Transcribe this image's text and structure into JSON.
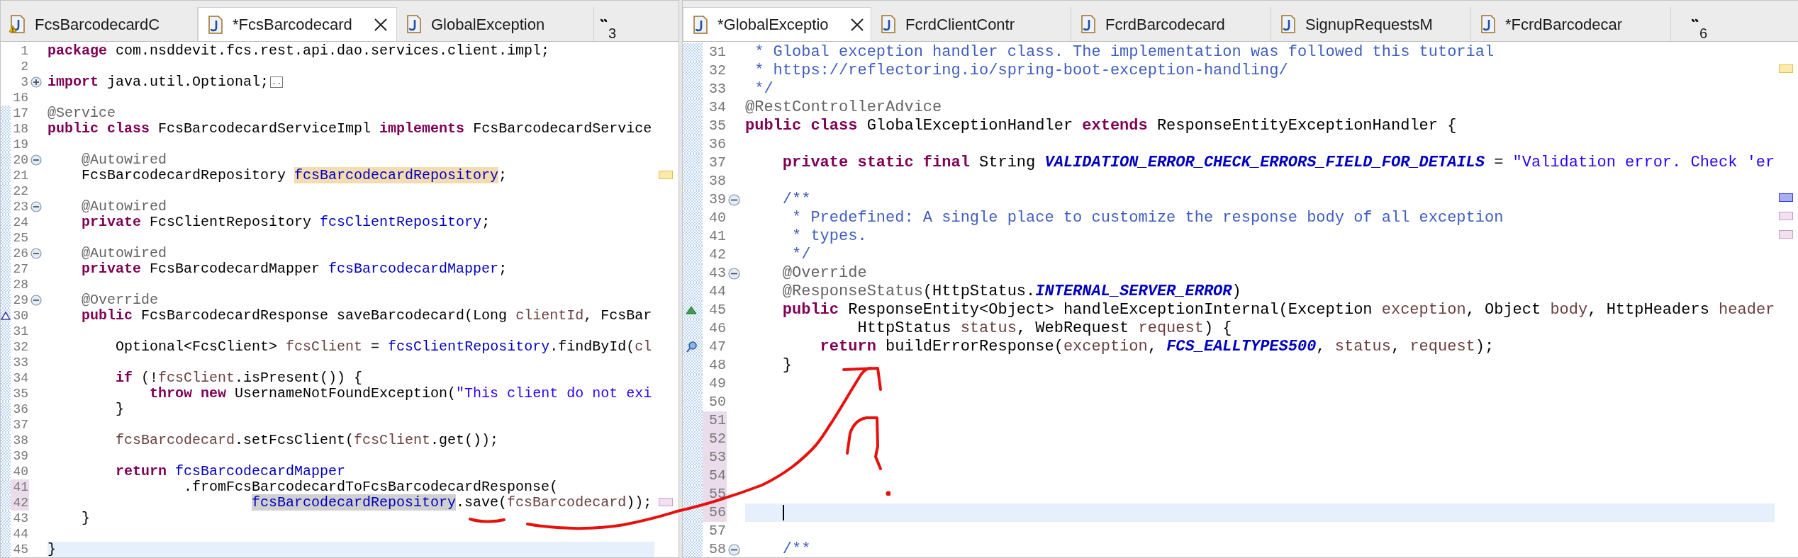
{
  "editors": [
    {
      "focused": false,
      "overflow_count": "3",
      "tabs": [
        {
          "label": "FcsBarcodecardC",
          "selected": false,
          "warning": true
        },
        {
          "label": "*FcsBarcodecard",
          "selected": true,
          "warning": false
        },
        {
          "label": "GlobalException",
          "selected": false,
          "warning": false
        }
      ],
      "lines": [
        {
          "number": "1",
          "current": false,
          "hatched": false,
          "modified": false,
          "segments": [
            {
              "kind": "keyword",
              "text": "package"
            },
            {
              "kind": "plain",
              "text": " com.nsddevit.fcs.rest.api.dao.services.client.impl;"
            }
          ]
        },
        {
          "number": "2",
          "current": false,
          "hatched": false,
          "modified": false
        },
        {
          "number": "3",
          "current": false,
          "hatched": false,
          "modified": false,
          "collapsed": true,
          "segments": [
            {
              "kind": "keyword",
              "text": "import"
            },
            {
              "kind": "plain",
              "text": " java.util.Optional;"
            },
            {
              "kind": "folded",
              "text": ".."
            }
          ]
        },
        {
          "number": "16",
          "current": false,
          "hatched": false,
          "modified": false
        },
        {
          "number": "17",
          "current": false,
          "hatched": true,
          "modified": false,
          "segments": [
            {
              "kind": "annotation",
              "text": "@Service"
            }
          ]
        },
        {
          "number": "18",
          "current": false,
          "hatched": true,
          "modified": false,
          "segments": [
            {
              "kind": "keyword",
              "text": "public class"
            },
            {
              "kind": "plain",
              "text": " FcsBarcodecardServiceImpl "
            },
            {
              "kind": "keyword",
              "text": "implements"
            },
            {
              "kind": "plain",
              "text": " FcsBarcodecardService"
            }
          ]
        },
        {
          "number": "19",
          "current": false,
          "hatched": true,
          "modified": false
        },
        {
          "number": "20",
          "current": false,
          "hatched": true,
          "modified": false,
          "collapsed": false,
          "segments": [
            {
              "kind": "annotation",
              "text": "    @Autowired"
            }
          ]
        },
        {
          "number": "21",
          "current": false,
          "hatched": true,
          "modified": false,
          "ruler": {
            "kind": "occurrence"
          },
          "segments": [
            {
              "kind": "plain",
              "text": "    FcsBarcodecardRepository "
            },
            {
              "kind": "field",
              "text": "fcsBarcodecardRepository",
              "highlight": {
                "kind": "occurrence"
              }
            },
            {
              "kind": "plain",
              "text": ";"
            }
          ]
        },
        {
          "number": "22",
          "current": false,
          "hatched": true,
          "modified": false
        },
        {
          "number": "23",
          "current": false,
          "hatched": true,
          "modified": false,
          "collapsed": false,
          "segments": [
            {
              "kind": "annotation",
              "text": "    @Autowired"
            }
          ]
        },
        {
          "number": "24",
          "current": false,
          "hatched": true,
          "modified": false,
          "segments": [
            {
              "kind": "keyword",
              "text": "    private"
            },
            {
              "kind": "plain",
              "text": " FcsClientRepository "
            },
            {
              "kind": "field",
              "text": "fcsClientRepository"
            },
            {
              "kind": "plain",
              "text": ";"
            }
          ]
        },
        {
          "number": "25",
          "current": false,
          "hatched": true,
          "modified": false
        },
        {
          "number": "26",
          "current": false,
          "hatched": true,
          "modified": false,
          "collapsed": false,
          "segments": [
            {
              "kind": "annotation",
              "text": "    @Autowired"
            }
          ]
        },
        {
          "number": "27",
          "current": false,
          "hatched": true,
          "modified": false,
          "segments": [
            {
              "kind": "keyword",
              "text": "    private"
            },
            {
              "kind": "plain",
              "text": " FcsBarcodecardMapper "
            },
            {
              "kind": "field",
              "text": "fcsBarcodecardMapper"
            },
            {
              "kind": "plain",
              "text": ";"
            }
          ]
        },
        {
          "number": "28",
          "current": false,
          "hatched": true,
          "modified": false
        },
        {
          "number": "29",
          "current": false,
          "hatched": true,
          "modified": false,
          "collapsed": false,
          "segments": [
            {
              "kind": "annotation",
              "text": "    @Override"
            }
          ]
        },
        {
          "number": "30",
          "current": false,
          "hatched": true,
          "modified": false,
          "marker": {
            "kind": "override-outline"
          },
          "segments": [
            {
              "kind": "keyword",
              "text": "    public"
            },
            {
              "kind": "plain",
              "text": " FcsBarcodecardResponse saveBarcodecard(Long "
            },
            {
              "kind": "local",
              "text": "clientId"
            },
            {
              "kind": "plain",
              "text": ", FcsBar"
            }
          ]
        },
        {
          "number": "31",
          "current": false,
          "hatched": true,
          "modified": false
        },
        {
          "number": "32",
          "current": false,
          "hatched": true,
          "modified": false,
          "segments": [
            {
              "kind": "plain",
              "text": "        Optional<FcsClient> "
            },
            {
              "kind": "local",
              "text": "fcsClient"
            },
            {
              "kind": "plain",
              "text": " = "
            },
            {
              "kind": "field",
              "text": "fcsClientRepository"
            },
            {
              "kind": "plain",
              "text": ".findById("
            },
            {
              "kind": "local",
              "text": "cl"
            }
          ]
        },
        {
          "number": "33",
          "current": false,
          "hatched": true,
          "modified": false
        },
        {
          "number": "34",
          "current": false,
          "hatched": true,
          "modified": false,
          "segments": [
            {
              "kind": "keyword",
              "text": "        if"
            },
            {
              "kind": "plain",
              "text": " (!"
            },
            {
              "kind": "local",
              "text": "fcsClient"
            },
            {
              "kind": "plain",
              "text": ".isPresent()) {"
            }
          ]
        },
        {
          "number": "35",
          "current": false,
          "hatched": true,
          "modified": false,
          "segments": [
            {
              "kind": "keyword",
              "text": "            throw new"
            },
            {
              "kind": "plain",
              "text": " UsernameNotFoundException("
            },
            {
              "kind": "string",
              "text": "\"This client do not exi"
            }
          ]
        },
        {
          "number": "36",
          "current": false,
          "hatched": true,
          "modified": false,
          "segments": [
            {
              "kind": "plain",
              "text": "        }"
            }
          ]
        },
        {
          "number": "37",
          "current": false,
          "hatched": true,
          "modified": false
        },
        {
          "number": "38",
          "current": false,
          "hatched": true,
          "modified": false,
          "segments": [
            {
              "kind": "local",
              "text": "        fcsBarcodecard"
            },
            {
              "kind": "plain",
              "text": ".setFcsClient("
            },
            {
              "kind": "local",
              "text": "fcsClient"
            },
            {
              "kind": "plain",
              "text": ".get());"
            }
          ]
        },
        {
          "number": "39",
          "current": false,
          "hatched": true,
          "modified": false
        },
        {
          "number": "40",
          "current": false,
          "hatched": true,
          "modified": false,
          "segments": [
            {
              "kind": "keyword",
              "text": "        return "
            },
            {
              "kind": "field",
              "text": "fcsBarcodecardMapper"
            }
          ]
        },
        {
          "number": "41",
          "current": false,
          "hatched": true,
          "modified": true,
          "segments": [
            {
              "kind": "plain",
              "text": "                .fromFcsBarcodecardToFcsBarcodecardResponse("
            }
          ]
        },
        {
          "number": "42",
          "current": false,
          "hatched": true,
          "modified": true,
          "ruler": {
            "kind": "change"
          },
          "segments": [
            {
              "kind": "field",
              "text": "                        fcsBarcodecardRepository",
              "highlight": {
                "kind": "selection"
              }
            },
            {
              "kind": "plain",
              "text": ".save("
            },
            {
              "kind": "local",
              "text": "fcsBarcodecard"
            },
            {
              "kind": "plain",
              "text": "));"
            }
          ]
        },
        {
          "number": "43",
          "current": false,
          "hatched": true,
          "modified": false,
          "segments": [
            {
              "kind": "plain",
              "text": "    }"
            }
          ]
        },
        {
          "number": "44",
          "current": false,
          "hatched": true,
          "modified": false
        },
        {
          "number": "45",
          "current": true,
          "hatched": true,
          "modified": false,
          "segments": [
            {
              "kind": "plain",
              "text": "}"
            }
          ]
        }
      ]
    },
    {
      "focused": true,
      "overflow_count": "6",
      "tabs": [
        {
          "label": "*GlobalExceptio",
          "selected": true,
          "warning": false
        },
        {
          "label": "FcrdClientContr",
          "selected": false,
          "warning": false
        },
        {
          "label": "FcrdBarcodecard",
          "selected": false,
          "warning": false
        },
        {
          "label": "SignupRequestsM",
          "selected": false,
          "warning": false
        },
        {
          "label": "*FcrdBarcodecar",
          "selected": false,
          "warning": false
        }
      ],
      "lines": [
        {
          "number": "31",
          "current": false,
          "hatched": true,
          "modified": false,
          "segments": [
            {
              "kind": "doc",
              "text": " * Global exception handler class. The implementation was followed this tutorial"
            }
          ]
        },
        {
          "number": "32",
          "current": false,
          "hatched": true,
          "modified": false,
          "ruler": {
            "kind": "occurrence"
          },
          "segments": [
            {
              "kind": "doc",
              "text": " * https://reflectoring.io/spring-boot-exception-handling/"
            }
          ]
        },
        {
          "number": "33",
          "current": false,
          "hatched": true,
          "modified": false,
          "segments": [
            {
              "kind": "doc",
              "text": " */"
            }
          ]
        },
        {
          "number": "34",
          "current": false,
          "hatched": true,
          "modified": false,
          "segments": [
            {
              "kind": "annotation",
              "text": "@RestControllerAdvice"
            }
          ]
        },
        {
          "number": "35",
          "current": false,
          "hatched": true,
          "modified": false,
          "segments": [
            {
              "kind": "keyword",
              "text": "public class"
            },
            {
              "kind": "plain",
              "text": " GlobalExceptionHandler "
            },
            {
              "kind": "keyword",
              "text": "extends"
            },
            {
              "kind": "plain",
              "text": " ResponseEntityExceptionHandler {"
            }
          ]
        },
        {
          "number": "36",
          "current": false,
          "hatched": true,
          "modified": false
        },
        {
          "number": "37",
          "current": false,
          "hatched": true,
          "modified": false,
          "segments": [
            {
              "kind": "keyword",
              "text": "    private static final"
            },
            {
              "kind": "plain",
              "text": " String "
            },
            {
              "kind": "constant",
              "text": "VALIDATION_ERROR_CHECK_ERRORS_FIELD_FOR_DETAILS"
            },
            {
              "kind": "plain",
              "text": " = "
            },
            {
              "kind": "string",
              "text": "\"Validation error. Check 'er"
            }
          ]
        },
        {
          "number": "38",
          "current": false,
          "hatched": true,
          "modified": false
        },
        {
          "number": "39",
          "current": false,
          "hatched": true,
          "modified": false,
          "collapsed": false,
          "ruler": {
            "kind": "task"
          },
          "segments": [
            {
              "kind": "doc",
              "text": "    /**"
            }
          ]
        },
        {
          "number": "40",
          "current": false,
          "hatched": true,
          "modified": false,
          "ruler": {
            "kind": "change"
          },
          "segments": [
            {
              "kind": "doc",
              "text": "     * Predefined: A single place to customize the response body of all exception"
            }
          ]
        },
        {
          "number": "41",
          "current": false,
          "hatched": true,
          "modified": false,
          "ruler": {
            "kind": "change"
          },
          "segments": [
            {
              "kind": "doc",
              "text": "     * types."
            }
          ]
        },
        {
          "number": "42",
          "current": false,
          "hatched": true,
          "modified": false,
          "segments": [
            {
              "kind": "doc",
              "text": "     */"
            }
          ]
        },
        {
          "number": "43",
          "current": false,
          "hatched": true,
          "modified": false,
          "collapsed": false,
          "segments": [
            {
              "kind": "annotation",
              "text": "    @Override"
            }
          ]
        },
        {
          "number": "44",
          "current": false,
          "hatched": true,
          "modified": false,
          "segments": [
            {
              "kind": "annotation",
              "text": "    @ResponseStatus"
            },
            {
              "kind": "plain",
              "text": "(HttpStatus."
            },
            {
              "kind": "constant",
              "text": "INTERNAL_SERVER_ERROR"
            },
            {
              "kind": "plain",
              "text": ")"
            }
          ]
        },
        {
          "number": "45",
          "current": false,
          "hatched": true,
          "modified": false,
          "marker": {
            "kind": "override"
          },
          "segments": [
            {
              "kind": "keyword",
              "text": "    public"
            },
            {
              "kind": "plain",
              "text": " ResponseEntity<Object> handleExceptionInternal(Exception "
            },
            {
              "kind": "local",
              "text": "exception"
            },
            {
              "kind": "plain",
              "text": ", Object "
            },
            {
              "kind": "local",
              "text": "body"
            },
            {
              "kind": "plain",
              "text": ", HttpHeaders "
            },
            {
              "kind": "local",
              "text": "header"
            }
          ]
        },
        {
          "number": "46",
          "current": false,
          "hatched": true,
          "modified": false,
          "segments": [
            {
              "kind": "plain",
              "text": "            HttpStatus "
            },
            {
              "kind": "local",
              "text": "status"
            },
            {
              "kind": "plain",
              "text": ", WebRequest "
            },
            {
              "kind": "local",
              "text": "request"
            },
            {
              "kind": "plain",
              "text": ") {"
            }
          ]
        },
        {
          "number": "47",
          "current": false,
          "hatched": true,
          "modified": false,
          "marker": {
            "kind": "search"
          },
          "segments": [
            {
              "kind": "keyword",
              "text": "        return"
            },
            {
              "kind": "plain",
              "text": " buildErrorResponse("
            },
            {
              "kind": "local",
              "text": "exception"
            },
            {
              "kind": "plain",
              "text": ", "
            },
            {
              "kind": "constant",
              "text": "FCS_EALLTYPES500"
            },
            {
              "kind": "plain",
              "text": ", "
            },
            {
              "kind": "local",
              "text": "status"
            },
            {
              "kind": "plain",
              "text": ", "
            },
            {
              "kind": "local",
              "text": "request"
            },
            {
              "kind": "plain",
              "text": ");"
            }
          ]
        },
        {
          "number": "48",
          "current": false,
          "hatched": true,
          "modified": false,
          "segments": [
            {
              "kind": "plain",
              "text": "    }"
            }
          ]
        },
        {
          "number": "49",
          "current": false,
          "hatched": true,
          "modified": false
        },
        {
          "number": "50",
          "current": false,
          "hatched": true,
          "modified": false
        },
        {
          "number": "51",
          "current": false,
          "hatched": true,
          "modified": true
        },
        {
          "number": "52",
          "current": false,
          "hatched": true,
          "modified": true
        },
        {
          "number": "53",
          "current": false,
          "hatched": true,
          "modified": true
        },
        {
          "number": "54",
          "current": false,
          "hatched": true,
          "modified": true
        },
        {
          "number": "55",
          "current": false,
          "hatched": true,
          "modified": true
        },
        {
          "number": "56",
          "current": true,
          "hatched": true,
          "modified": true
        },
        {
          "number": "57",
          "current": false,
          "hatched": true,
          "modified": false
        },
        {
          "number": "58",
          "current": false,
          "hatched": true,
          "modified": false,
          "collapsed": false,
          "segments": [
            {
              "kind": "doc",
              "text": "    /**"
            }
          ]
        }
      ]
    }
  ]
}
